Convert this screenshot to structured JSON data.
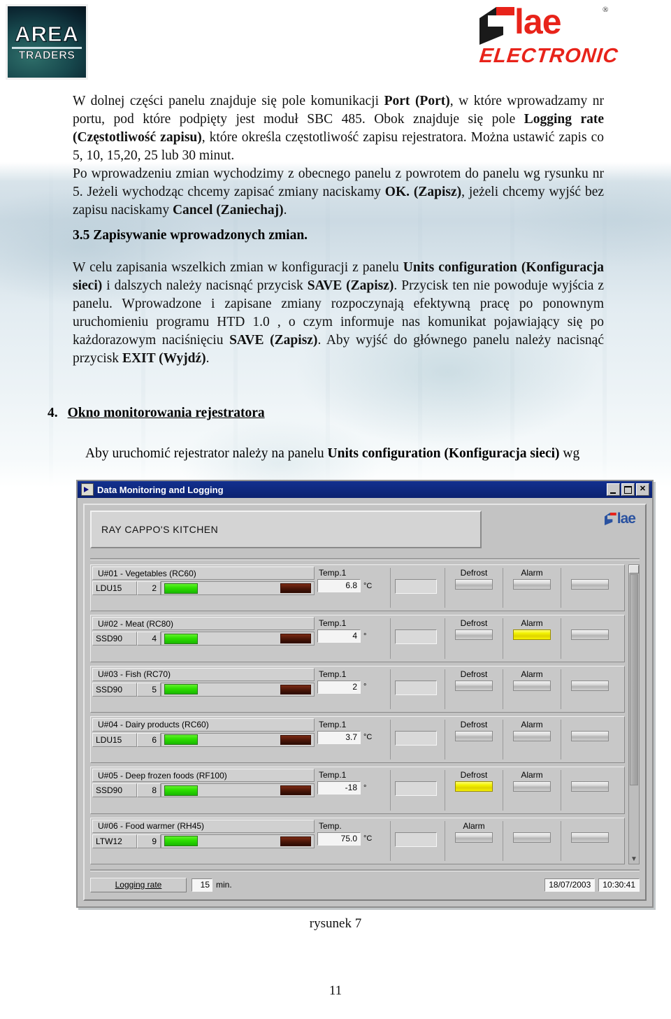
{
  "header": {
    "area_logo": {
      "line1": "AREA",
      "line2": "TRADERS"
    },
    "lae_logo": {
      "word": "lae",
      "sub": "ELECTRONIC",
      "registered": "®"
    }
  },
  "document": {
    "paragraph_1": "W dolnej części panelu znajduje się pole komunikacji ",
    "p1_b1": "Port (Port)",
    "p1_t2": ", w które wprowadzamy nr portu, pod które podpięty jest moduł SBC 485. Obok znajduje się pole ",
    "p1_b2": "Logging rate (Częstotliwość zapisu)",
    "p1_t3": ", które określa częstotliwość zapisu rejestratora. Można ustawić zapis co 5, 10, 15,20, 25 lub 30 minut.",
    "p2_t1": "Po wprowadzeniu zmian wychodzimy z obecnego panelu z powrotem do panelu wg rysunku nr 5. Jeżeli wychodząc chcemy zapisać zmiany naciskamy ",
    "p2_b1": "OK. (Zapisz)",
    "p2_t2": ", jeżeli chcemy wyjść bez zapisu naciskamy ",
    "p2_b2": "Cancel (Zaniechaj)",
    "p2_t3": ".",
    "heading_35": "3.5 Zapisywanie wprowadzonych zmian.",
    "p3_t1": "W celu zapisania wszelkich zmian w konfiguracji z panelu ",
    "p3_b1": "Units configuration (Konfiguracja sieci)",
    "p3_t2": " i dalszych należy nacisnąć przycisk ",
    "p3_b2": "SAVE (Zapisz)",
    "p3_t3": ". Przycisk ten nie powoduje wyjścia z panelu. Wprowadzone i zapisane zmiany rozpoczynają efektywną pracę po ponownym uruchomieniu programu HTD 1.0 , o czym informuje nas komunikat pojawiający się po każdorazowym naciśnięciu ",
    "p3_b3": "SAVE (Zapisz)",
    "p3_t4": ". Aby wyjść do głównego panelu należy nacisnąć przycisk ",
    "p3_b4": "EXIT (Wyjdź)",
    "p3_t5": ".",
    "section4_number": "4.",
    "section4_title": "Okno monitorowania rejestratora",
    "p4_t1": "Aby uruchomić rejestrator należy na panelu ",
    "p4_b1": "Units configuration (Konfiguracja sieci)",
    "p4_t2": " wg",
    "caption": "rysunek 7",
    "page_number": "11"
  },
  "app": {
    "title": "Data Monitoring and Logging",
    "window_buttons": {
      "minimize": "_",
      "maximize": "□",
      "close": "✕"
    },
    "site_name": "RAY CAPPO'S KITCHEN",
    "brand": "lae",
    "units": [
      {
        "name": "U#01 - Vegetables (RC60)",
        "model": "LDU15",
        "address": "2",
        "temp_label": "Temp.1",
        "temp_value": "6.8",
        "temp_unit": "°C",
        "buttons": [
          {
            "label": "Defrost",
            "on": false
          },
          {
            "label": "Alarm",
            "on": false
          },
          {
            "label": "",
            "on": false
          }
        ]
      },
      {
        "name": "U#02 - Meat (RC80)",
        "model": "SSD90",
        "address": "4",
        "temp_label": "Temp.1",
        "temp_value": "4",
        "temp_unit": "°",
        "buttons": [
          {
            "label": "Defrost",
            "on": false
          },
          {
            "label": "Alarm",
            "on": true
          },
          {
            "label": "",
            "on": false
          }
        ]
      },
      {
        "name": "U#03 - Fish (RC70)",
        "model": "SSD90",
        "address": "5",
        "temp_label": "Temp.1",
        "temp_value": "2",
        "temp_unit": "°",
        "buttons": [
          {
            "label": "Defrost",
            "on": false
          },
          {
            "label": "Alarm",
            "on": false
          },
          {
            "label": "",
            "on": false
          }
        ]
      },
      {
        "name": "U#04 - Dairy products (RC60)",
        "model": "LDU15",
        "address": "6",
        "temp_label": "Temp.1",
        "temp_value": "3.7",
        "temp_unit": "°C",
        "buttons": [
          {
            "label": "Defrost",
            "on": false
          },
          {
            "label": "Alarm",
            "on": false
          },
          {
            "label": "",
            "on": false
          }
        ]
      },
      {
        "name": "U#05 - Deep frozen foods (RF100)",
        "model": "SSD90",
        "address": "8",
        "temp_label": "Temp.1",
        "temp_value": "-18",
        "temp_unit": "°",
        "buttons": [
          {
            "label": "Defrost",
            "on": true
          },
          {
            "label": "Alarm",
            "on": false
          },
          {
            "label": "",
            "on": false
          }
        ]
      },
      {
        "name": "U#06 - Food warmer (RH45)",
        "model": "LTW12",
        "address": "9",
        "temp_label": "Temp.",
        "temp_value": "75.0",
        "temp_unit": "°C",
        "buttons": [
          {
            "label": "Alarm",
            "on": false
          },
          {
            "label": "",
            "on": false
          },
          {
            "label": "",
            "on": false
          }
        ]
      }
    ],
    "status": {
      "logging_rate_label": "Logging rate",
      "logging_rate_value": "15",
      "logging_rate_unit": "min.",
      "date": "18/07/2003",
      "time": "10:30:41"
    },
    "colors": {
      "titlebar": "#12308f",
      "face": "#c3c3c3",
      "led_on_green": "#2ee000",
      "led_off_brown": "#4a1508",
      "lamp_on_yellow": "#f2f200"
    }
  }
}
